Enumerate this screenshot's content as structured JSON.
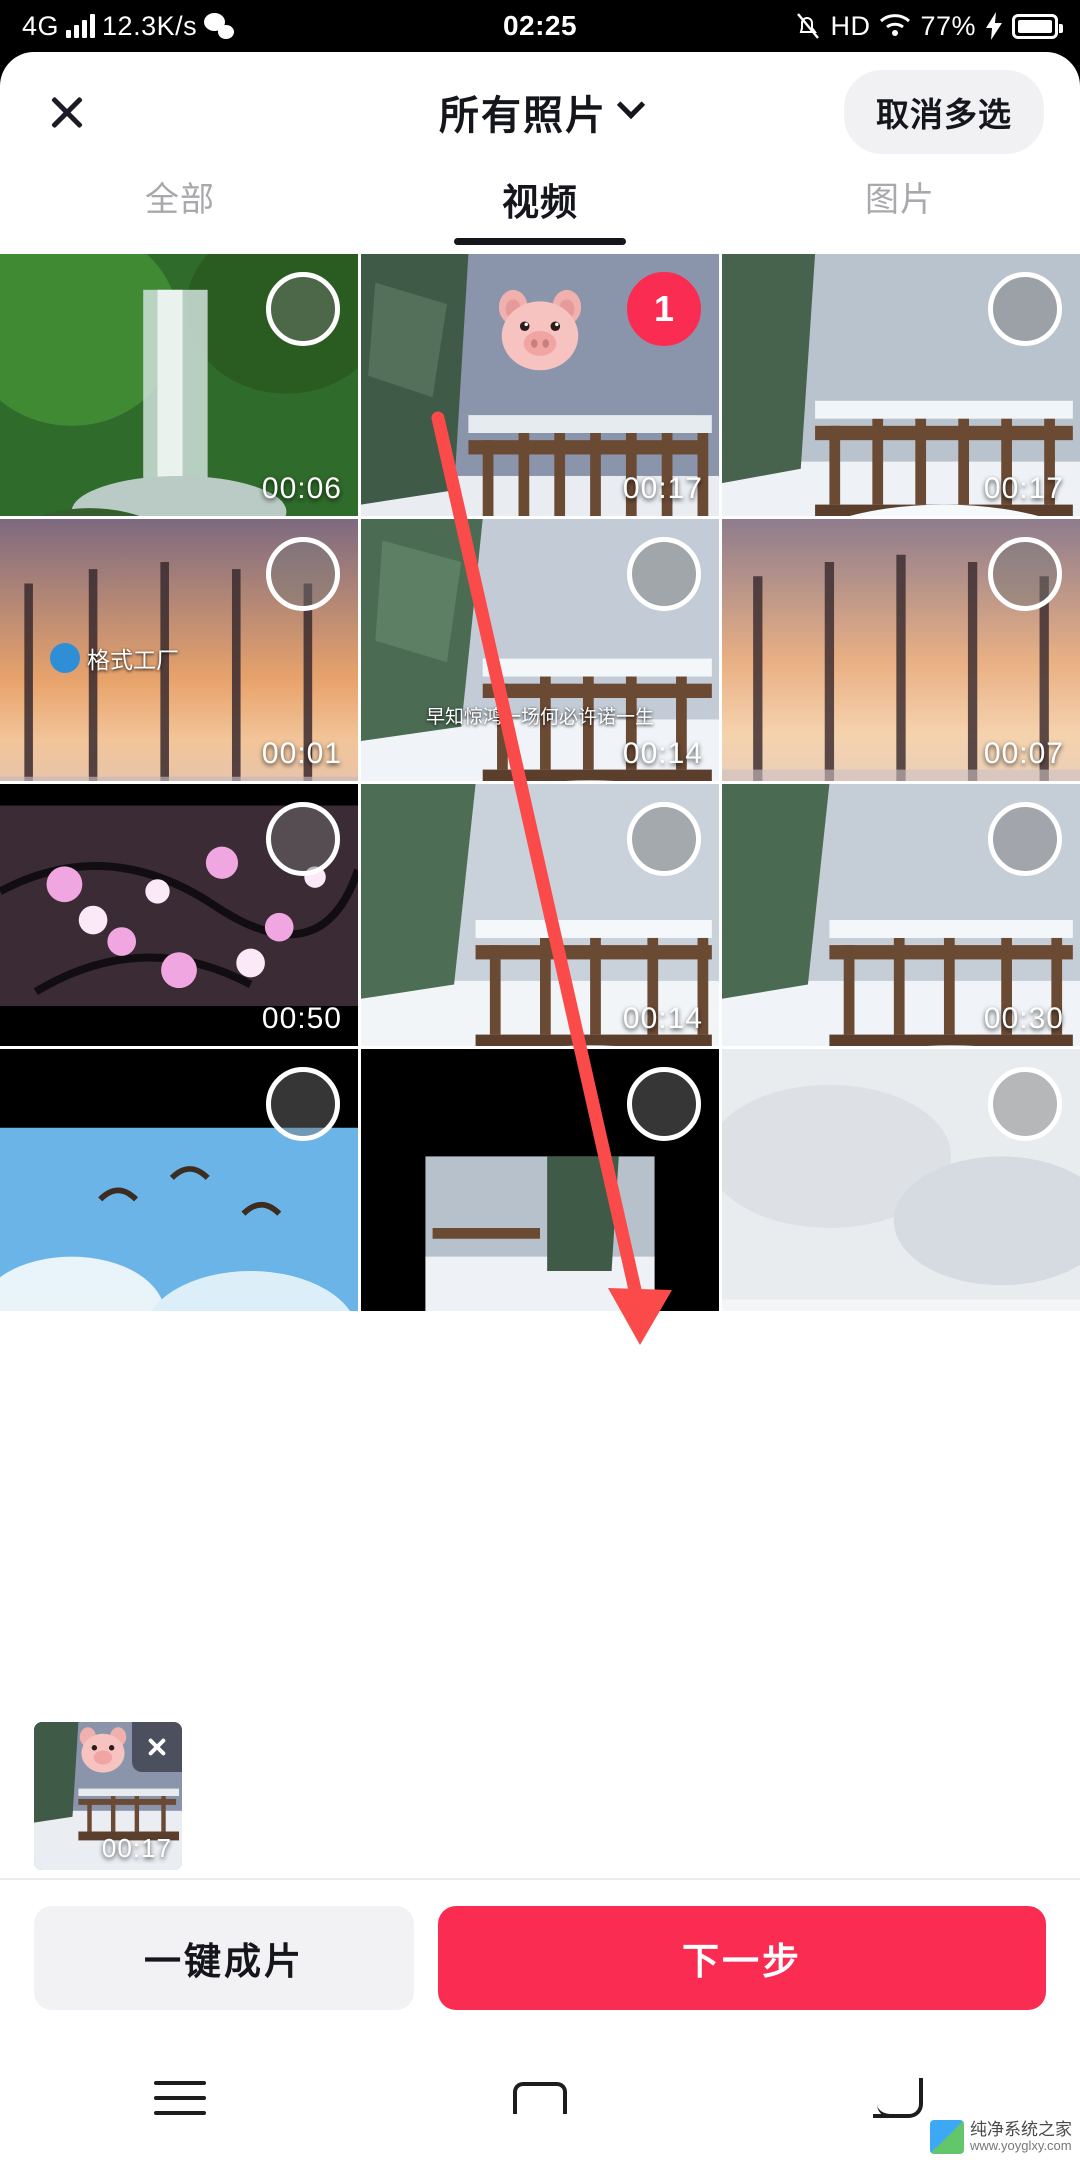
{
  "status_bar": {
    "network_type": "4G",
    "data_speed": "12.3K/s",
    "app_icon": "wechat-icon",
    "time": "02:25",
    "mute_icon": "bell-muted-icon",
    "hd": "HD",
    "wifi_icon": "wifi-icon",
    "battery_percent": "77%",
    "charging_icon": "bolt-icon"
  },
  "header": {
    "close_icon": "close-icon",
    "title": "所有照片",
    "dropdown_icon": "chevron-down-icon",
    "multi_select_button": "取消多选"
  },
  "tabs": [
    {
      "label": "全部",
      "active": false
    },
    {
      "label": "视频",
      "active": true
    },
    {
      "label": "图片",
      "active": false
    }
  ],
  "grid": {
    "items": [
      {
        "duration": "00:06",
        "selected": false,
        "badge": "",
        "scene": "waterfall"
      },
      {
        "duration": "00:17",
        "selected": true,
        "badge": "1",
        "scene": "snow-bridge-pig"
      },
      {
        "duration": "00:17",
        "selected": false,
        "badge": "",
        "scene": "snow-bridge"
      },
      {
        "duration": "00:01",
        "selected": false,
        "badge": "",
        "scene": "sunset-trees-watermark"
      },
      {
        "duration": "00:14",
        "selected": false,
        "badge": "",
        "scene": "snow-bridge-caption"
      },
      {
        "duration": "00:07",
        "selected": false,
        "badge": "",
        "scene": "sunset-trees"
      },
      {
        "duration": "00:50",
        "selected": false,
        "badge": "",
        "scene": "pink-blossom-night"
      },
      {
        "duration": "00:14",
        "selected": false,
        "badge": "",
        "scene": "snow-bridge"
      },
      {
        "duration": "00:30",
        "selected": false,
        "badge": "",
        "scene": "snow-bridge"
      },
      {
        "duration": "",
        "selected": false,
        "badge": "",
        "scene": "birds-sky"
      },
      {
        "duration": "",
        "selected": false,
        "badge": "",
        "scene": "snow-dark"
      },
      {
        "duration": "",
        "selected": false,
        "badge": "",
        "scene": "fog-white"
      }
    ],
    "watermark_text": "格式工厂",
    "caption_text": "早知惊鸿一场何必许诺一生"
  },
  "selected_strip": {
    "item_duration": "00:17",
    "remove_icon": "close-icon"
  },
  "action_bar": {
    "oneclick_label": "一键成片",
    "next_label": "下一步",
    "next_color": "#fb2c52"
  },
  "nav_bar": {
    "recents_icon": "menu-icon",
    "home_icon": "home-icon",
    "back_icon": "back-icon",
    "watermark": "纯净系统之家",
    "watermark_url": "www.yoyglxy.com"
  },
  "annotation": {
    "arrow_color": "#fb4a4a"
  }
}
